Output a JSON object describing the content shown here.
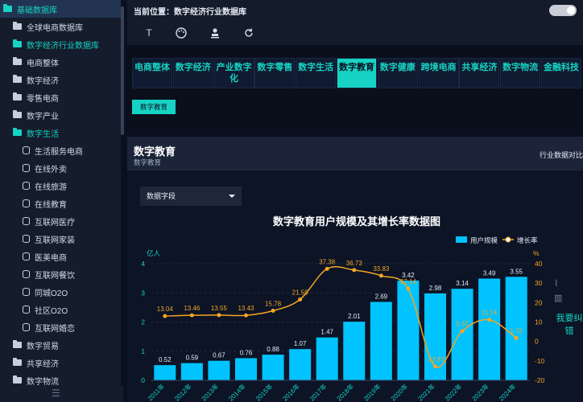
{
  "sidebar": {
    "items": [
      {
        "label": "基础数据库",
        "icon": "folder-icon",
        "level": 0,
        "active": true,
        "highlight": true
      },
      {
        "label": "全球电商数据库",
        "icon": "folder-icon",
        "level": 1
      },
      {
        "label": "数字经济行业数据库",
        "icon": "folder-icon",
        "level": 1,
        "active": true
      },
      {
        "label": "电商整体",
        "icon": "folder-icon",
        "level": 2
      },
      {
        "label": "数字经济",
        "icon": "folder-icon",
        "level": 2
      },
      {
        "label": "零售电商",
        "icon": "folder-icon",
        "level": 2
      },
      {
        "label": "数字产业",
        "icon": "folder-icon",
        "level": 2
      },
      {
        "label": "数字生活",
        "icon": "folder-icon",
        "level": 2,
        "active": true
      },
      {
        "label": "生活服务电商",
        "icon": "database-icon",
        "level": 3
      },
      {
        "label": "在线外卖",
        "icon": "database-icon",
        "level": 3
      },
      {
        "label": "在线旅游",
        "icon": "database-icon",
        "level": 3
      },
      {
        "label": "在线教育",
        "icon": "database-icon",
        "level": 3
      },
      {
        "label": "互联网医疗",
        "icon": "database-icon",
        "level": 3
      },
      {
        "label": "互联网家装",
        "icon": "database-icon",
        "level": 3
      },
      {
        "label": "医美电商",
        "icon": "database-icon",
        "level": 3
      },
      {
        "label": "互联网餐饮",
        "icon": "database-icon",
        "level": 3
      },
      {
        "label": "同城O2O",
        "icon": "database-icon",
        "level": 3
      },
      {
        "label": "社区O2O",
        "icon": "database-icon",
        "level": 3
      },
      {
        "label": "互联网婚恋",
        "icon": "database-icon",
        "level": 3
      },
      {
        "label": "数字贸易",
        "icon": "folder-icon",
        "level": 2
      },
      {
        "label": "共享经济",
        "icon": "folder-icon",
        "level": 2
      },
      {
        "label": "数字物流",
        "icon": "folder-icon",
        "level": 2
      }
    ]
  },
  "header": {
    "breadcrumb": "当前位置：数字经济行业数据库",
    "tools": [
      "text-icon",
      "palette-icon",
      "stamp-icon",
      "refresh-icon"
    ]
  },
  "tabs": [
    {
      "label": "电商整体"
    },
    {
      "label": "数字经济"
    },
    {
      "label": "产业数字化"
    },
    {
      "label": "数字零售"
    },
    {
      "label": "数字生活"
    },
    {
      "label": "数字教育",
      "active": true
    },
    {
      "label": "数字健康"
    },
    {
      "label": "跨境电商"
    },
    {
      "label": "共享经济"
    },
    {
      "label": "数字物流"
    },
    {
      "label": "金融科技"
    }
  ],
  "sub_tag": "数字教育",
  "panel": {
    "title": "数字教育",
    "subtitle": "数字教育",
    "compare_link": "行业数据对比",
    "field_select": "数据字段"
  },
  "feedback": "我要纠错",
  "colors": {
    "accent": "#17d3c4",
    "bar": "#00c3ff",
    "line": "#f5a623"
  },
  "chart_data": {
    "type": "bar",
    "title": "数字教育用户规模及其增长率数据图",
    "categories": [
      "2011年",
      "2012年",
      "2013年",
      "2014年",
      "2015年",
      "2016年",
      "2017年",
      "2018年",
      "2019年",
      "2020年",
      "2021年",
      "2022年",
      "2023年",
      "2024年"
    ],
    "series": [
      {
        "name": "用户规模",
        "type": "bar",
        "axis": "left",
        "values": [
          0.52,
          0.59,
          0.67,
          0.76,
          0.88,
          1.07,
          1.47,
          2.01,
          2.69,
          3.42,
          2.98,
          3.14,
          3.49,
          3.55
        ]
      },
      {
        "name": "增长率",
        "type": "line",
        "axis": "right",
        "values": [
          13.04,
          13.46,
          13.55,
          13.43,
          15.78,
          21.59,
          37.38,
          36.73,
          33.83,
          27.14,
          -12.87,
          5.37,
          11.14,
          1.72
        ]
      }
    ],
    "ylabel_left": "亿人",
    "ylabel_right": "%",
    "ylim_left": [
      0,
      4
    ],
    "ylim_right": [
      -20,
      40
    ],
    "yticks_left": [
      0,
      1,
      2,
      3,
      4
    ],
    "yticks_right": [
      -20,
      -10,
      0,
      10,
      20,
      30,
      40
    ],
    "legend_position": "top-right",
    "grid": true
  }
}
